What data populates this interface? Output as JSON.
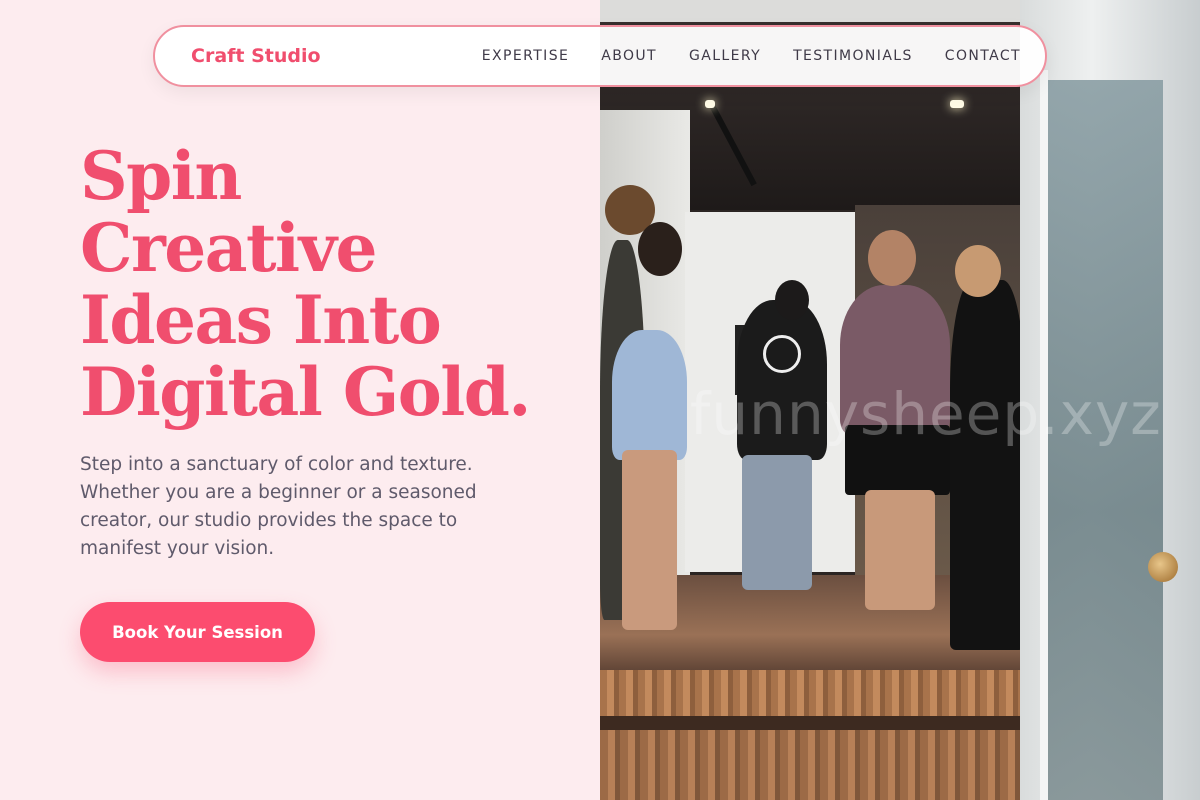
{
  "nav": {
    "brand": "Craft Studio",
    "links": [
      "EXPERTISE",
      "ABOUT",
      "GALLERY",
      "TESTIMONIALS",
      "CONTACT"
    ]
  },
  "hero": {
    "headline_lines": [
      "Spin",
      "Creative",
      "Ideas Into",
      "Digital Gold."
    ],
    "subtext": "Step into a sanctuary of color and texture. Whether you are a beginner or a seasoned creator, our studio provides the space to manifest your vision.",
    "cta_label": "Book Your Session"
  },
  "photo": {
    "watermark": "funnysheep.xyz"
  },
  "colors": {
    "accent": "#fc4c6f",
    "headline": "#f04e6e",
    "background": "#fdecef",
    "body_text": "#5f5a6b",
    "nav_border": "#f0909f"
  }
}
